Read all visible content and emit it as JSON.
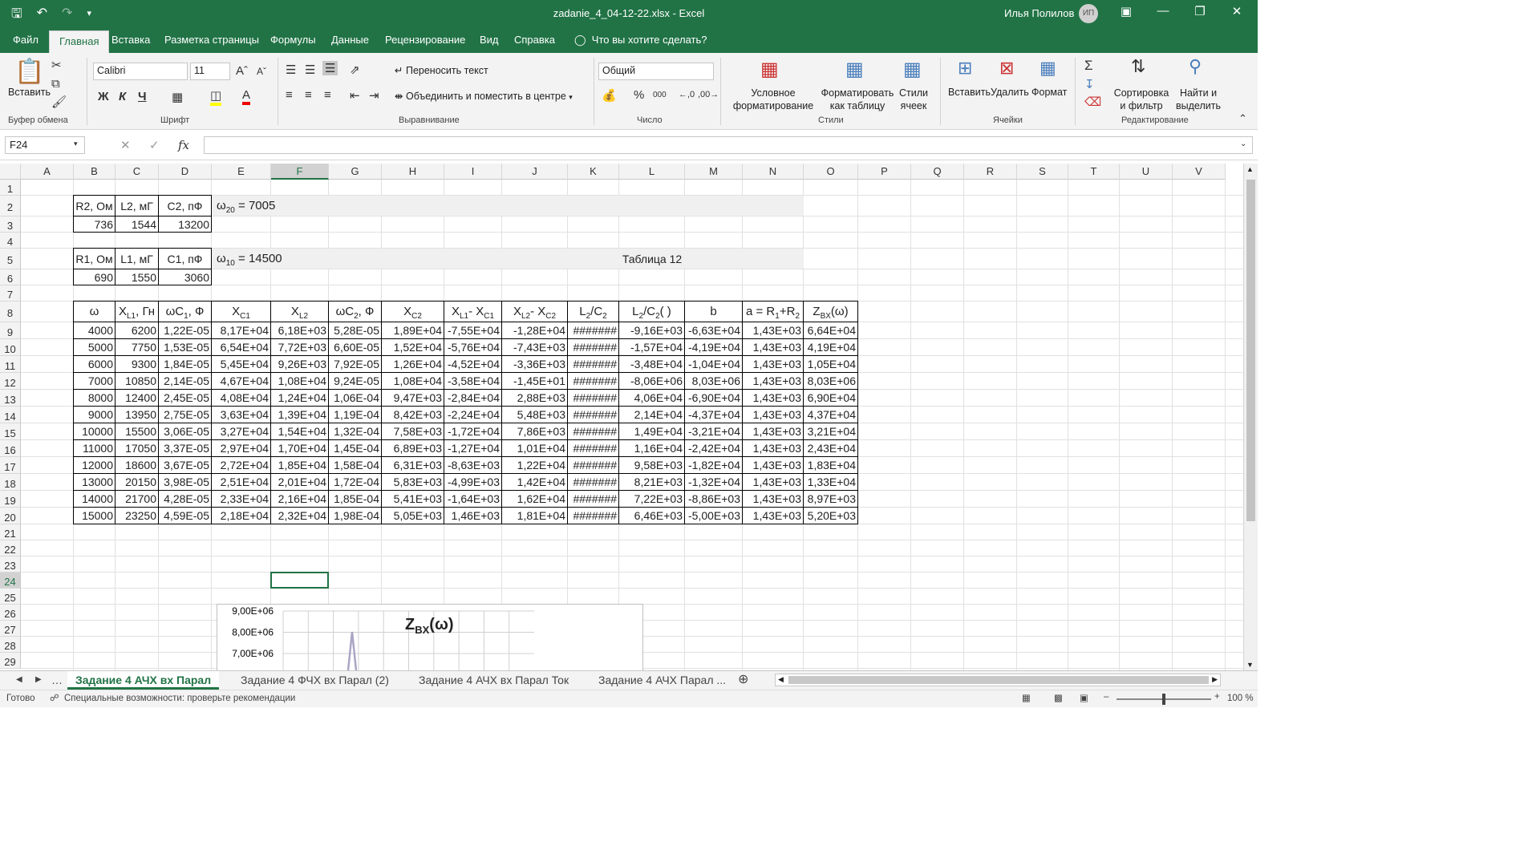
{
  "window": {
    "title": "zadanie_4_04-12-22.xlsx  -  Excel",
    "user": "Илья Полилов",
    "avatar_initials": "ИП"
  },
  "ribbon_tabs": [
    "Файл",
    "Главная",
    "Вставка",
    "Разметка страницы",
    "Формулы",
    "Данные",
    "Рецензирование",
    "Вид",
    "Справка"
  ],
  "tell_me": "Что вы хотите сделать?",
  "ribbon": {
    "paste_label": "Вставить",
    "clipboard_group": "Буфер обмена",
    "font_name": "Calibri",
    "font_size": "11",
    "font_group": "Шрифт",
    "wrap_text": "Переносить текст",
    "merge_center": "Объединить и поместить в центре",
    "alignment_group": "Выравнивание",
    "number_format": "Общий",
    "number_group": "Число",
    "cond_format_l1": "Условное",
    "cond_format_l2": "форматирование",
    "format_table_l1": "Форматировать",
    "format_table_l2": "как таблицу",
    "cell_styles_l1": "Стили",
    "cell_styles_l2": "ячеек",
    "styles_group": "Стили",
    "insert_label": "Вставить",
    "delete_label": "Удалить",
    "format_label": "Формат",
    "cells_group": "Ячейки",
    "sort_l1": "Сортировка",
    "sort_l2": "и фильтр",
    "find_l1": "Найти и",
    "find_l2": "выделить",
    "editing_group": "Редактирование"
  },
  "formula_bar": {
    "name_box": "F24",
    "fx": "fx"
  },
  "columns": [
    "A",
    "B",
    "C",
    "D",
    "E",
    "F",
    "G",
    "H",
    "I",
    "J",
    "K",
    "L",
    "M",
    "N",
    "O",
    "P",
    "Q",
    "R",
    "S",
    "T",
    "U",
    "V"
  ],
  "rows": [
    "1",
    "2",
    "3",
    "4",
    "5",
    "6",
    "7",
    "8",
    "9",
    "10",
    "11",
    "12",
    "13",
    "14",
    "15",
    "16",
    "17",
    "18",
    "19",
    "20",
    "21",
    "22",
    "23",
    "24",
    "25",
    "26",
    "27",
    "28",
    "29"
  ],
  "params2": {
    "headers": [
      "R2,  Ом",
      "L2, мГ",
      "C2, пФ"
    ],
    "values": [
      "736",
      "1544",
      "13200"
    ]
  },
  "params1": {
    "headers": [
      "R1,  Ом",
      "L1, мГ",
      "C1, пФ"
    ],
    "values": [
      "690",
      "1550",
      "3060"
    ]
  },
  "omega20": {
    "label": "ω",
    "sub": "20",
    "rest": " = 7005"
  },
  "omega10": {
    "label": "ω",
    "sub": "10",
    "rest": " = 14500"
  },
  "table_title": "Таблица 12",
  "main_table": {
    "headers": [
      "ω",
      "X_L1, Гн",
      "ωC_1, Ф",
      "X_C1",
      "X_L2",
      "ωC_2, Ф",
      "X_C2",
      "X_L1- X_C1",
      "X_L2- X_C2",
      "L_2/C_2",
      "L_2/C_2( )",
      "b",
      "a = R_1+R_2",
      "Z_BX(ω)"
    ],
    "header_parts": [
      [
        [
          "ω",
          ""
        ]
      ],
      [
        [
          "X",
          ""
        ],
        [
          "L1",
          "sub"
        ],
        [
          ", Гн",
          ""
        ]
      ],
      [
        [
          "ωC",
          ""
        ],
        [
          "1",
          "sub"
        ],
        [
          ", Ф",
          ""
        ]
      ],
      [
        [
          "X",
          ""
        ],
        [
          "C1",
          "sub"
        ]
      ],
      [
        [
          "X",
          ""
        ],
        [
          "L2",
          "sub"
        ]
      ],
      [
        [
          "ωC",
          ""
        ],
        [
          "2",
          "sub"
        ],
        [
          ", Ф",
          ""
        ]
      ],
      [
        [
          "X",
          ""
        ],
        [
          "C2",
          "sub"
        ]
      ],
      [
        [
          "X",
          ""
        ],
        [
          "L1",
          "sub"
        ],
        [
          "- X",
          ""
        ],
        [
          "C1",
          "sub"
        ]
      ],
      [
        [
          "X",
          ""
        ],
        [
          "L2",
          "sub"
        ],
        [
          "- X",
          ""
        ],
        [
          "C2",
          "sub"
        ]
      ],
      [
        [
          "L",
          ""
        ],
        [
          "2",
          "sub"
        ],
        [
          "/C",
          ""
        ],
        [
          "2",
          "sub"
        ]
      ],
      [
        [
          "L",
          ""
        ],
        [
          "2",
          "sub"
        ],
        [
          "/C",
          ""
        ],
        [
          "2",
          "sub"
        ],
        [
          "( )",
          ""
        ]
      ],
      [
        [
          "b",
          ""
        ]
      ],
      [
        [
          "a = R",
          ""
        ],
        [
          "1",
          "sub"
        ],
        [
          "+R",
          ""
        ],
        [
          "2",
          "sub"
        ]
      ],
      [
        [
          "Z",
          ""
        ],
        [
          "BX",
          "sub"
        ],
        [
          "(ω)",
          ""
        ]
      ]
    ],
    "rows": [
      [
        "4000",
        "6200",
        "1,22E-05",
        "8,17E+04",
        "6,18E+03",
        "5,28E-05",
        "1,89E+04",
        "-7,55E+04",
        "-1,28E+04",
        "#######",
        "-9,16E+03",
        "-6,63E+04",
        "1,43E+03",
        "6,64E+04"
      ],
      [
        "5000",
        "7750",
        "1,53E-05",
        "6,54E+04",
        "7,72E+03",
        "6,60E-05",
        "1,52E+04",
        "-5,76E+04",
        "-7,43E+03",
        "#######",
        "-1,57E+04",
        "-4,19E+04",
        "1,43E+03",
        "4,19E+04"
      ],
      [
        "6000",
        "9300",
        "1,84E-05",
        "5,45E+04",
        "9,26E+03",
        "7,92E-05",
        "1,26E+04",
        "-4,52E+04",
        "-3,36E+03",
        "#######",
        "-3,48E+04",
        "-1,04E+04",
        "1,43E+03",
        "1,05E+04"
      ],
      [
        "7000",
        "10850",
        "2,14E-05",
        "4,67E+04",
        "1,08E+04",
        "9,24E-05",
        "1,08E+04",
        "-3,58E+04",
        "-1,45E+01",
        "#######",
        "-8,06E+06",
        "8,03E+06",
        "1,43E+03",
        "8,03E+06"
      ],
      [
        "8000",
        "12400",
        "2,45E-05",
        "4,08E+04",
        "1,24E+04",
        "1,06E-04",
        "9,47E+03",
        "-2,84E+04",
        "2,88E+03",
        "#######",
        "4,06E+04",
        "-6,90E+04",
        "1,43E+03",
        "6,90E+04"
      ],
      [
        "9000",
        "13950",
        "2,75E-05",
        "3,63E+04",
        "1,39E+04",
        "1,19E-04",
        "8,42E+03",
        "-2,24E+04",
        "5,48E+03",
        "#######",
        "2,14E+04",
        "-4,37E+04",
        "1,43E+03",
        "4,37E+04"
      ],
      [
        "10000",
        "15500",
        "3,06E-05",
        "3,27E+04",
        "1,54E+04",
        "1,32E-04",
        "7,58E+03",
        "-1,72E+04",
        "7,86E+03",
        "#######",
        "1,49E+04",
        "-3,21E+04",
        "1,43E+03",
        "3,21E+04"
      ],
      [
        "11000",
        "17050",
        "3,37E-05",
        "2,97E+04",
        "1,70E+04",
        "1,45E-04",
        "6,89E+03",
        "-1,27E+04",
        "1,01E+04",
        "#######",
        "1,16E+04",
        "-2,42E+04",
        "1,43E+03",
        "2,43E+04"
      ],
      [
        "12000",
        "18600",
        "3,67E-05",
        "2,72E+04",
        "1,85E+04",
        "1,58E-04",
        "6,31E+03",
        "-8,63E+03",
        "1,22E+04",
        "#######",
        "9,58E+03",
        "-1,82E+04",
        "1,43E+03",
        "1,83E+04"
      ],
      [
        "13000",
        "20150",
        "3,98E-05",
        "2,51E+04",
        "2,01E+04",
        "1,72E-04",
        "5,83E+03",
        "-4,99E+03",
        "1,42E+04",
        "#######",
        "8,21E+03",
        "-1,32E+04",
        "1,43E+03",
        "1,33E+04"
      ],
      [
        "14000",
        "21700",
        "4,28E-05",
        "2,33E+04",
        "2,16E+04",
        "1,85E-04",
        "5,41E+03",
        "-1,64E+03",
        "1,62E+04",
        "#######",
        "7,22E+03",
        "-8,86E+03",
        "1,43E+03",
        "8,97E+03"
      ],
      [
        "15000",
        "23250",
        "4,59E-05",
        "2,18E+04",
        "2,32E+04",
        "1,98E-04",
        "5,05E+03",
        "1,46E+03",
        "1,81E+04",
        "#######",
        "6,46E+03",
        "-5,00E+03",
        "1,43E+03",
        "5,20E+03"
      ]
    ]
  },
  "chart": {
    "title_main": "Z",
    "title_sub": "BX",
    "title_rest": "(ω)",
    "y_ticks": [
      "9,00E+06",
      "8,00E+06",
      "7,00E+06"
    ]
  },
  "sheet_tabs": [
    "Задание 4 АЧХ вх Парал",
    "Задание 4 ФЧХ вх Парал  (2)",
    "Задание 4 АЧХ вх Парал Ток",
    "Задание 4 АЧХ Парал ..."
  ],
  "status": {
    "ready": "Готово",
    "accessibility": "Специальные возможности: проверьте рекомендации",
    "zoom": "100 %"
  },
  "colors": {
    "accent": "#217346",
    "ribbon_bg": "#f3f3f3"
  }
}
